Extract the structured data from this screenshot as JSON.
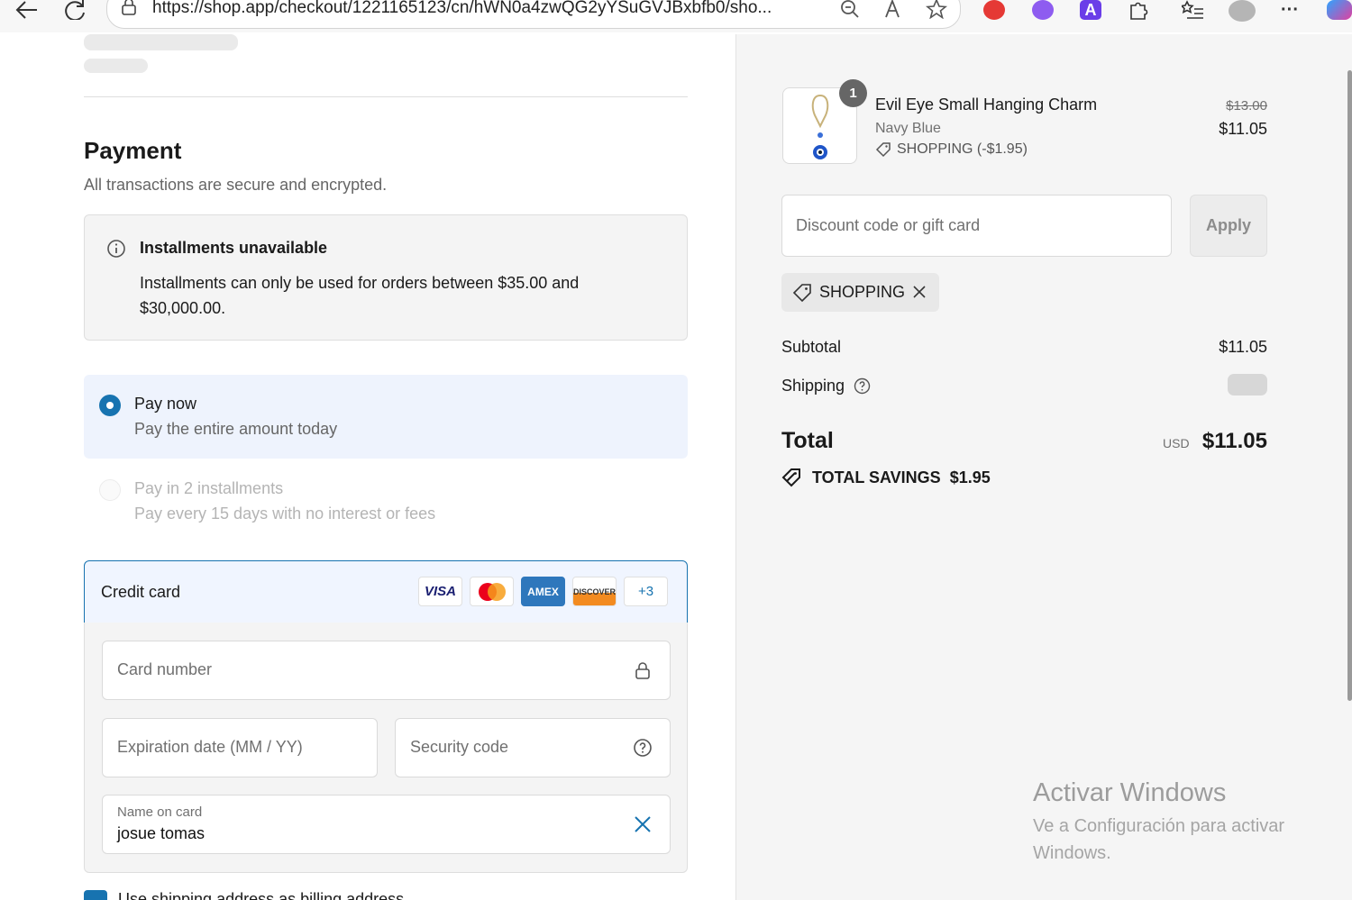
{
  "browser": {
    "url": "https://shop.app/checkout/1221165123/cn/hWN0a4zwQG2yYSuGVJBxbfb0/sho..."
  },
  "payment": {
    "title": "Payment",
    "subtitle": "All transactions are secure and encrypted.",
    "notice": {
      "title": "Installments unavailable",
      "body": "Installments can only be used for orders between $35.00 and $30,000.00."
    },
    "options": [
      {
        "title": "Pay now",
        "description": "Pay the entire amount today",
        "selected": true
      },
      {
        "title": "Pay in 2 installments",
        "description": "Pay every 15 days with no interest or fees",
        "selected": false
      }
    ],
    "credit_card": {
      "label": "Credit card",
      "logos": [
        "VISA",
        "Mastercard",
        "AMEX",
        "DISCOVER"
      ],
      "more": "+3",
      "card_number_placeholder": "Card number",
      "expiration_placeholder": "Expiration date (MM / YY)",
      "security_placeholder": "Security code",
      "name_label": "Name on card",
      "name_value": "josue tomas"
    },
    "billing_checkbox": "Use shipping address as billing address"
  },
  "summary": {
    "item": {
      "quantity": "1",
      "name": "Evil Eye Small Hanging Charm",
      "variant": "Navy Blue",
      "discount": "SHOPPING (-$1.95)",
      "original_price": "$13.00",
      "price": "$11.05"
    },
    "discount_placeholder": "Discount code or gift card",
    "apply_label": "Apply",
    "applied_code": "SHOPPING",
    "subtotal_label": "Subtotal",
    "subtotal_value": "$11.05",
    "shipping_label": "Shipping",
    "total_label": "Total",
    "currency": "USD",
    "total_value": "$11.05",
    "savings_label": "TOTAL SAVINGS",
    "savings_value": "$1.95"
  },
  "watermark": {
    "line1": "Activar Windows",
    "line2": "Ve a Configuración para activar Windows."
  },
  "colors": {
    "accent": "#1773b0",
    "selected_bg": "#eef3fd"
  }
}
